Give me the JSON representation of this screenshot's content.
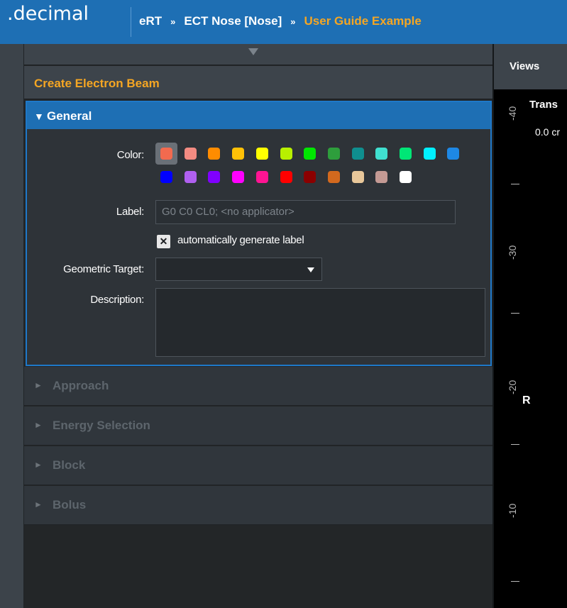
{
  "app": {
    "logo": ".decimal"
  },
  "breadcrumb": {
    "items": [
      "eRT",
      "ECT Nose [Nose]"
    ],
    "current": "User Guide Example",
    "separator": "»"
  },
  "panel": {
    "title": "Create Electron Beam"
  },
  "general": {
    "header": "General",
    "color_label": "Color:",
    "colors": [
      "#f26a4f",
      "#f28b82",
      "#ff8c00",
      "#ffc107",
      "#ffff00",
      "#b8f000",
      "#00e600",
      "#2e9e3c",
      "#0f8f8f",
      "#40e0d0",
      "#00e676",
      "#00f0ff",
      "#1e88e5",
      "#0000ff",
      "#b060f0",
      "#8000ff",
      "#ff00ff",
      "#ff1493",
      "#ff0000",
      "#8b0000",
      "#d2691e",
      "#e8c79a",
      "#c49a94",
      "#ffffff"
    ],
    "selected_color": "#f26a4f",
    "label_label": "Label:",
    "label_value": "G0 C0 CL0;  <no applicator>",
    "auto_label_checked": "✕",
    "auto_label_text": "automatically generate label",
    "geometric_target_label": "Geometric Target:",
    "geometric_target_value": "",
    "description_label": "Description:",
    "description_value": ""
  },
  "sections": [
    "Approach",
    "Energy Selection",
    "Block",
    "Bolus"
  ],
  "views": {
    "tab_label": "Views",
    "overlay_title": "Trans",
    "overlay_sub": "0.0 cr",
    "ruler_labels": [
      "-40",
      "-30",
      "-20",
      "-10"
    ],
    "orientation_marker": "R"
  }
}
